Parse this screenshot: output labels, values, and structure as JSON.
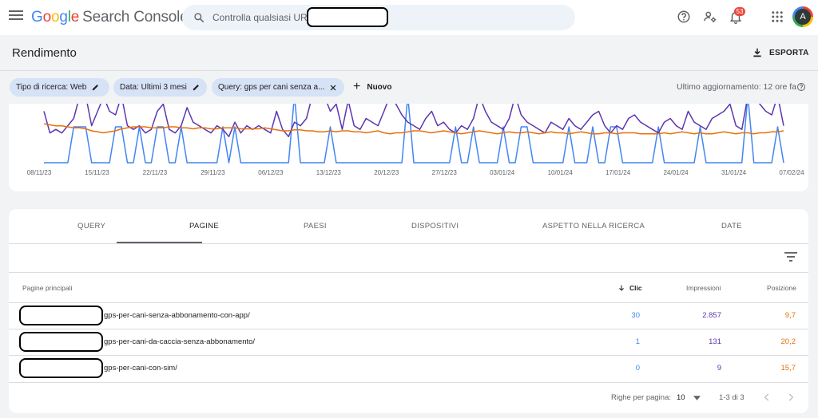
{
  "app": {
    "logo": {
      "g1": "G",
      "o1": "o",
      "o2": "o",
      "g2": "g",
      "l": "l",
      "e": "e",
      "product": "Search Console"
    },
    "search_placeholder": "Controlla qualsiasi URL",
    "notifications_count": "53",
    "avatar_letter": "A"
  },
  "page": {
    "title": "Rendimento",
    "export_label": "ESPORTA",
    "last_update": "Ultimo aggiornamento: 12 ore fa"
  },
  "filters": {
    "chips": [
      {
        "label": "Tipo di ricerca: Web",
        "action": "edit"
      },
      {
        "label": "Data: Ultimi 3 mesi",
        "action": "edit"
      },
      {
        "label": "Query: gps per cani senza a...",
        "action": "remove"
      }
    ],
    "new_label": "Nuovo"
  },
  "chart_data": {
    "type": "line",
    "x_tick_labels": [
      "08/11/23",
      "15/11/23",
      "22/11/23",
      "29/11/23",
      "06/12/23",
      "13/12/23",
      "20/12/23",
      "27/12/23",
      "03/01/24",
      "10/01/24",
      "17/01/24",
      "24/01/24",
      "31/01/24",
      "07/02/24"
    ],
    "series": [
      {
        "color": "#4285f4",
        "values": [
          0,
          0,
          0,
          0,
          0,
          1,
          1,
          1,
          0,
          0,
          0,
          0,
          1,
          1,
          0,
          0,
          1,
          0,
          0,
          1,
          1,
          0,
          0,
          1,
          0,
          0,
          0,
          0,
          0,
          0,
          1,
          0,
          1,
          0,
          0,
          0,
          0,
          0,
          0,
          0,
          0,
          0,
          3,
          0,
          0,
          0,
          0,
          0,
          1,
          0,
          0,
          0,
          0,
          0,
          0,
          0,
          0,
          0,
          0,
          0,
          0,
          3,
          0,
          0,
          0,
          0,
          0,
          0,
          0,
          1,
          0,
          0,
          1,
          0,
          0,
          0,
          0,
          1,
          0,
          0,
          1,
          1,
          0,
          0,
          0,
          0,
          0,
          0,
          1,
          0,
          0,
          0,
          1,
          0,
          0,
          1,
          1,
          0,
          0,
          0,
          0,
          0,
          0,
          1,
          0,
          0,
          0,
          0,
          0,
          0,
          1,
          0,
          0,
          0,
          0,
          0,
          0,
          0,
          2,
          0,
          0,
          0,
          0,
          1,
          0
        ]
      },
      {
        "color": "#5e35b1",
        "values": [
          60,
          30,
          35,
          30,
          40,
          50,
          85,
          95,
          40,
          60,
          80,
          60,
          55,
          85,
          40,
          35,
          40,
          30,
          35,
          60,
          70,
          35,
          30,
          40,
          65,
          45,
          40,
          35,
          30,
          40,
          35,
          25,
          45,
          30,
          40,
          35,
          40,
          35,
          30,
          60,
          35,
          25,
          45,
          40,
          50,
          110,
          90,
          85,
          60,
          70,
          35,
          75,
          40,
          35,
          50,
          45,
          40,
          60,
          85,
          70,
          55,
          45,
          40,
          35,
          50,
          60,
          40,
          45,
          35,
          30,
          40,
          35,
          50,
          85,
          60,
          45,
          40,
          35,
          50,
          90,
          55,
          45,
          40,
          35,
          30,
          45,
          40,
          35,
          50,
          40,
          35,
          45,
          55,
          60,
          40,
          30,
          40,
          35,
          50,
          55,
          45,
          40,
          35,
          30,
          45,
          50,
          40,
          35,
          60,
          45,
          40,
          35,
          50,
          55,
          60,
          70,
          40,
          35,
          85,
          95,
          70,
          60,
          55,
          85,
          40
        ]
      },
      {
        "color": "#e8710a",
        "values": [
          35,
          34,
          33,
          33,
          32,
          31,
          31,
          30,
          28,
          27,
          26,
          27,
          28,
          30,
          31,
          32,
          32,
          32,
          31,
          31,
          31,
          32,
          32,
          31,
          31,
          30,
          31,
          31,
          30,
          30,
          31,
          31,
          31,
          30,
          30,
          30,
          30,
          31,
          30,
          29,
          28,
          28,
          29,
          29,
          28,
          28,
          27,
          27,
          28,
          27,
          28,
          28,
          27,
          27,
          26,
          27,
          28,
          26,
          25,
          26,
          26,
          27,
          28,
          28,
          27,
          26,
          27,
          28,
          27,
          26,
          25,
          26,
          27,
          28,
          27,
          26,
          25,
          26,
          27,
          26,
          26,
          27,
          26,
          25,
          26,
          27,
          26,
          26,
          25,
          26,
          27,
          26,
          25,
          25,
          26,
          26,
          25,
          26,
          26,
          26,
          25,
          25,
          25,
          25,
          26,
          25,
          26,
          27,
          26,
          25,
          26,
          25,
          25,
          26,
          27,
          26,
          25,
          26,
          26,
          25,
          26,
          26,
          27,
          27,
          28
        ]
      }
    ]
  },
  "table": {
    "tabs": [
      "QUERY",
      "PAGINE",
      "PAESI",
      "DISPOSITIVI",
      "ASPETTO NELLA RICERCA",
      "DATE"
    ],
    "active_tab": "PAGINE",
    "columns": {
      "page": "Pagine principali",
      "clicks": "Clic",
      "impressions": "Impressioni",
      "position": "Posizione"
    },
    "rows": [
      {
        "path": "gps-per-cani-senza-abbonamento-con-app/",
        "clicks": "30",
        "impressions": "2.857",
        "position": "9,7"
      },
      {
        "path": "gps-per-cani-da-caccia-senza-abbonamento/",
        "clicks": "1",
        "impressions": "131",
        "position": "20,2"
      },
      {
        "path": "gps-per-cani-con-sim/",
        "clicks": "0",
        "impressions": "9",
        "position": "15,7"
      }
    ],
    "pager": {
      "rows_per_page_label": "Righe per pagina:",
      "rows_per_page": "10",
      "range": "1-3 di 3"
    }
  }
}
